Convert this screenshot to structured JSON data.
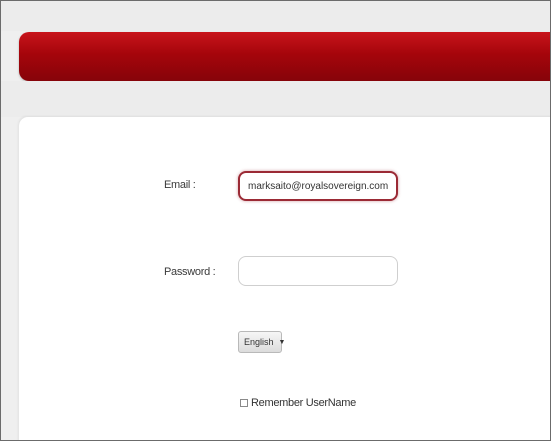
{
  "form": {
    "email_label": "Email :",
    "email_value": "marksaito@royalsovereign.com",
    "password_label": "Password :",
    "password_value": "",
    "language_selected": "English",
    "language_arrow_icon": "triangle-down-icon",
    "remember_label": "Remember UserName"
  },
  "colors": {
    "header_red": "#a5050b",
    "focus_border": "#9b2a35"
  }
}
